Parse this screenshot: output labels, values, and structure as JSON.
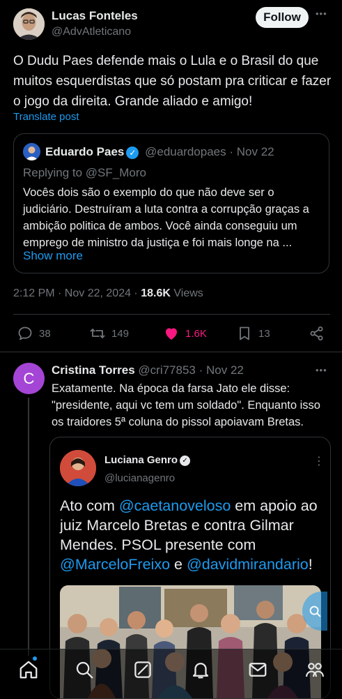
{
  "tweet": {
    "author_name": "Lucas Fonteles",
    "author_handle": "@AdvAtleticano",
    "follow_label": "Follow",
    "more_label": "•••",
    "text": "O Dudu Paes defende mais o Lula e o Brasil do que muitos esquerdistas que só postam pra criticar e fazer o jogo da direita. Grande aliado e amigo!",
    "translate_label": "Translate post",
    "quote": {
      "author_name": "Eduardo Paes",
      "author_handle": "@eduardopaes",
      "date": "· Nov 22",
      "replying_to": "Replying to @SF_Moro",
      "text": "Vocês dois são o exemplo do que não deve ser o judiciário. Destruíram a luta contra a corrupção graças a ambição politica de ambos. Você ainda conseguiu um emprego de ministro da justiça e foi mais longe na ...",
      "show_more": "Show more"
    },
    "timestamp": "2:12 PM · Nov 22, 2024 ·",
    "views_count": "18.6K",
    "views_label": "Views",
    "replies": "38",
    "retweets": "149",
    "likes": "1.6K",
    "bookmarks": "13"
  },
  "reply": {
    "avatar_letter": "C",
    "author_name": "Cristina Torres",
    "author_handle": "@cri77853",
    "date": "· Nov 22",
    "more_label": "•••",
    "text": "Exatamente. Na época da farsa Jato ele disse: \"presidente, aqui vc tem um soldado\". Enquanto isso os traidores 5ª coluna do pissol apoiavam Bretas.",
    "embedded": {
      "author_name": "Luciana Genro",
      "author_handle": "@lucianagenro",
      "more_label": "⋮",
      "text_before": "Ato com ",
      "mention1": "@caetanoveloso",
      "text_mid1": " em apoio ao juiz Marcelo Bretas e contra Gilmar Mendes. PSOL presente com ",
      "mention2": "@MarceloFreixo",
      "text_mid2": " e ",
      "mention3": "@davidmirandario",
      "text_end": "!"
    }
  },
  "colors": {
    "background": "#000000",
    "accent": "#1d9bf0",
    "like": "#f91880",
    "reply_avatar": "#a445d6"
  },
  "icons": [
    "reply-icon",
    "retweet-icon",
    "heart-icon",
    "bookmark-icon",
    "share-icon",
    "home-icon",
    "search-icon",
    "grok-icon",
    "notifications-icon",
    "messages-icon",
    "communities-icon"
  ]
}
